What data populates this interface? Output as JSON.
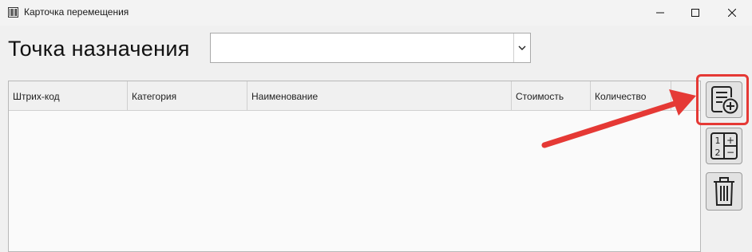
{
  "window": {
    "title": "Карточка перемещения",
    "app_icon": "barcode-app-icon",
    "controls": [
      "minimize-icon",
      "maximize-icon",
      "close-icon"
    ]
  },
  "destination": {
    "label": "Точка назначения",
    "selected_value": ""
  },
  "grid": {
    "columns": [
      "Штрих-код",
      "Категория",
      "Наименование",
      "Стоимость",
      "Количество",
      ""
    ],
    "rows": []
  },
  "side_buttons": [
    {
      "name": "add-document-button",
      "icon": "document-add-icon"
    },
    {
      "name": "quantity-button",
      "icon": "calculator-icon",
      "glyphs": [
        "1",
        "2",
        "+",
        "−"
      ]
    },
    {
      "name": "delete-button",
      "icon": "trash-icon"
    }
  ],
  "annotation": {
    "highlight_color": "#e53935",
    "arrow_color": "#e53935"
  }
}
